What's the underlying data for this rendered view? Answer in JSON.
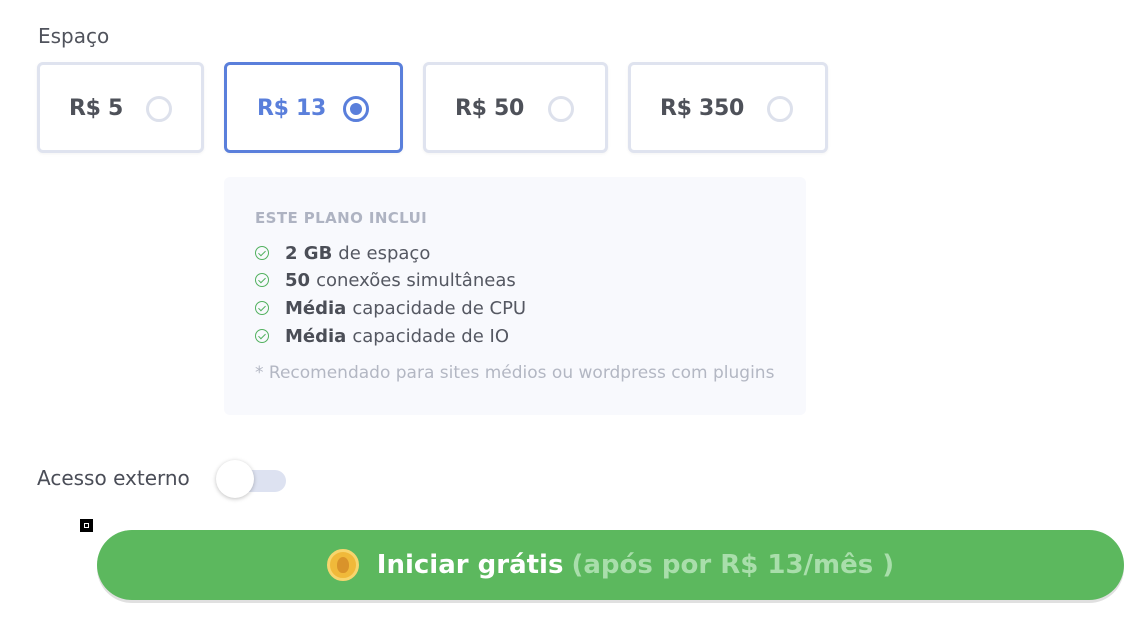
{
  "space": {
    "label": "Espaço",
    "options": [
      {
        "label": "R$ 5",
        "selected": false
      },
      {
        "label": "R$ 13",
        "selected": true
      },
      {
        "label": "R$ 50",
        "selected": false
      },
      {
        "label": "R$ 350",
        "selected": false
      }
    ]
  },
  "plan": {
    "title": "ESTE PLANO INCLUI",
    "features": [
      {
        "bold": "2 GB",
        "text": "de espaço",
        "icon": "check-circle-icon"
      },
      {
        "bold": "50",
        "text": "conexões simultâneas",
        "icon": "check-circle-icon"
      },
      {
        "bold": "Média",
        "text": "capacidade de CPU",
        "icon": "check-circle-icon"
      },
      {
        "bold": "Média",
        "text": "capacidade de IO",
        "icon": "check-circle-icon"
      }
    ],
    "note": "* Recomendado para sites médios ou wordpress com plugins"
  },
  "external_access": {
    "label": "Acesso externo",
    "enabled": false
  },
  "cta": {
    "icon": "coin-icon",
    "label": "Iniciar grátis",
    "sublabel": "(após por R$ 13/mês )"
  },
  "colors": {
    "accent": "#5a7fdb",
    "success": "#5cb85e",
    "check": "#52b15f"
  }
}
